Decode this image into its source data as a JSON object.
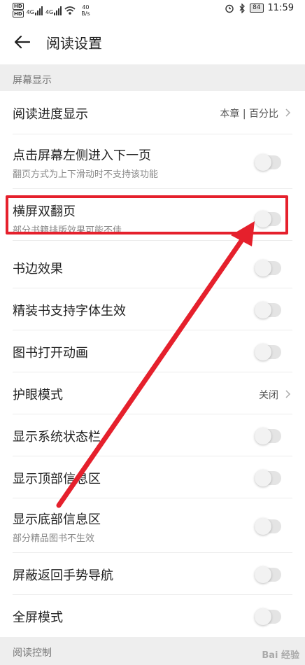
{
  "status_bar": {
    "hd1": "HD",
    "hd2": "HD",
    "signal": "4G",
    "speed_value": "40",
    "speed_unit": "B/s",
    "battery": "84",
    "time": "11:59",
    "icons": [
      "alarm-icon",
      "bluetooth-icon",
      "wifi-icon",
      "signal-icon"
    ]
  },
  "header": {
    "title": "阅读设置"
  },
  "sections": [
    {
      "label": "屏幕显示"
    },
    {
      "label": "阅读控制"
    }
  ],
  "rows": [
    {
      "title": "阅读进度显示",
      "value": "本章 | 百分比"
    },
    {
      "title": "点击屏幕左侧进入下一页",
      "sub": "翻页方式为上下滑动时不支持该功能",
      "toggle": false
    },
    {
      "title": "横屏双翻页",
      "sub": "部分书籍排版效果可能不佳",
      "toggle": false
    },
    {
      "title": "书边效果",
      "toggle": false
    },
    {
      "title": "精装书支持字体生效",
      "toggle": false
    },
    {
      "title": "图书打开动画",
      "toggle": false
    },
    {
      "title": "护眼模式",
      "value": "关闭"
    },
    {
      "title": "显示系统状态栏",
      "toggle": false
    },
    {
      "title": "显示顶部信息区",
      "toggle": false
    },
    {
      "title": "显示底部信息区",
      "sub": "部分精品图书不生效",
      "toggle": false
    },
    {
      "title": "屏蔽返回手势导航",
      "toggle": false
    },
    {
      "title": "全屏模式",
      "toggle": false
    }
  ],
  "annotation": {
    "box_color": "#e5202c",
    "arrow_color": "#e5202c"
  },
  "watermark": "Bai 经验"
}
